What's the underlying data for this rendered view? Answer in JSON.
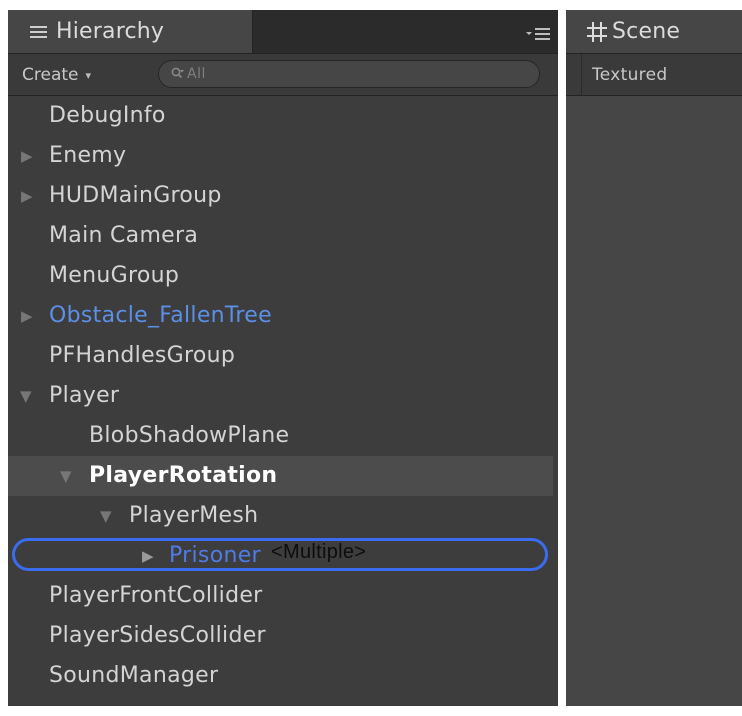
{
  "hierarchy": {
    "tab_label": "Hierarchy",
    "icons": {
      "tab_icon": "list-icon",
      "menu": "panel-menu-icon",
      "search": "search-icon",
      "create_caret": "caret-down-icon"
    },
    "create_label": "Create",
    "create_caret": "▾",
    "search_placeholder": "All",
    "items": [
      {
        "label": "DebugInfo",
        "depth": 0,
        "expander": ""
      },
      {
        "label": "Enemy",
        "depth": 0,
        "expander": "▶"
      },
      {
        "label": "HUDMainGroup",
        "depth": 0,
        "expander": "▶"
      },
      {
        "label": "Main Camera",
        "depth": 0,
        "expander": ""
      },
      {
        "label": "MenuGroup",
        "depth": 0,
        "expander": ""
      },
      {
        "label": "Obstacle_FallenTree",
        "depth": 0,
        "expander": "▶"
      },
      {
        "label": "PFHandlesGroup",
        "depth": 0,
        "expander": ""
      },
      {
        "label": "Player",
        "depth": 0,
        "expander": "▼"
      },
      {
        "label": "BlobShadowPlane",
        "depth": 1,
        "expander": ""
      },
      {
        "label": "PlayerRotation",
        "depth": 1,
        "expander": "▼"
      },
      {
        "label": "PlayerMesh",
        "depth": 2,
        "expander": "▼"
      },
      {
        "label": "Prisoner",
        "depth": 3,
        "expander": "▶"
      },
      {
        "label": "PlayerFrontCollider",
        "depth": 0,
        "expander": ""
      },
      {
        "label": "PlayerSidesCollider",
        "depth": 0,
        "expander": ""
      },
      {
        "label": "SoundManager",
        "depth": 0,
        "expander": ""
      }
    ],
    "tooltip": "<Multiple>",
    "colors": {
      "panel_bg": "#3d3d3d",
      "text": "#d4d4d4",
      "prefab_text": "#5c8fe6",
      "selected_row_bg": "#4c4c4c",
      "rename_outline": "#3a6cf0"
    }
  },
  "scene": {
    "tab_label": "Scene",
    "icons": {
      "tab_icon": "grid-icon"
    },
    "shading_mode": "Textured"
  }
}
